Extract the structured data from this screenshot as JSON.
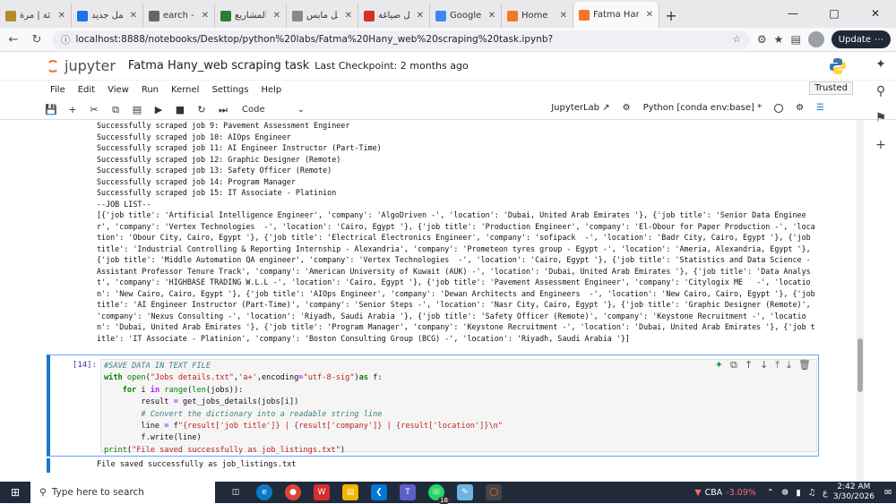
{
  "browser": {
    "tabs": [
      {
        "label": "المحادثة | مرة",
        "color": "#b58a2a"
      },
      {
        "label": "إضافة عمل جديد",
        "color": "#1a73e8"
      },
      {
        "label": "earch - كفيل",
        "color": "#666"
      },
      {
        "label": "المشاريع",
        "color": "#2e7d32"
      },
      {
        "label": "جوجل مابس",
        "color": "#888"
      },
      {
        "label": "محل صياغة",
        "color": "#d93025"
      },
      {
        "label": "Google Gem",
        "color": "#4285f4"
      },
      {
        "label": "Home",
        "color": "#f37726"
      },
      {
        "label": "Fatma Hany_",
        "color": "#f37726"
      }
    ],
    "url": "localhost:8888/notebooks/Desktop/python%20labs/Fatma%20Hany_web%20scraping%20task.ipynb?",
    "update_label": "Update"
  },
  "jupyter": {
    "brand": "jupyter",
    "notebook_title": "Fatma Hany_web scraping task",
    "checkpoint": "Last Checkpoint: 2 months ago",
    "menu": [
      "File",
      "Edit",
      "View",
      "Run",
      "Kernel",
      "Settings",
      "Help"
    ],
    "trusted": "Trusted",
    "cell_type": "Code",
    "jupyterlab_label": "JupyterLab",
    "kernel": "Python [conda env:base] *"
  },
  "output_text": "Successfully scraped job 9: Pavement Assessment Engineer\nSuccessfully scraped job 10: AIOps Engineer\nSuccessfully scraped job 11: AI Engineer Instructor (Part-Time)\nSuccessfully scraped job 12: Graphic Designer (Remote)\nSuccessfully scraped job 13: Safety Officer (Remote)\nSuccessfully scraped job 14: Program Manager\nSuccessfully scraped job 15: IT Associate - Platinion\n--JOB LIST--\n[{'job title': 'Artificial Intelligence Engineer', 'company': 'AlgoDriven -', 'location': 'Dubai, United Arab Emirates '}, {'job title': 'Senior Data Engineer', 'company': 'Vertex Technologies  -', 'location': 'Cairo, Egypt '}, {'job title': 'Production Engineer', 'company': 'El-Obour for Paper Production -', 'location': 'Obour City, Cairo, Egypt '}, {'job title': 'Electrical Electronics Engineer', 'company': 'sofipack  -', 'location': 'Badr City, Cairo, Egypt '}, {'job title': 'Industrial Controlling & Reporting Internship - Alexandria', 'company': 'Prometeon tyres group - Egypt -', 'location': 'Ameria, Alexandria, Egypt '}, {'job title': 'Middle Automation QA engineer', 'company': 'Vertex Technologies  -', 'location': 'Cairo, Egypt '}, {'job title': 'Statistics and Data Science - Assistant Professor Tenure Track', 'company': 'American University of Kuwait (AUK) -', 'location': 'Dubai, United Arab Emirates '}, {'job title': 'Data Analyst', 'company': 'HIGHBASE TRADING W.L.L -', 'location': 'Cairo, Egypt '}, {'job title': 'Pavement Assessment Engineer', 'company': 'Citylogix ME   -', 'location': 'New Cairo, Cairo, Egypt '}, {'job title': 'AIOps Engineer', 'company': 'Dewan Architects and Engineers  -', 'location': 'New Cairo, Cairo, Egypt '}, {'job title': 'AI Engineer Instructor (Part-Time)', 'company': 'Senior Steps -', 'location': 'Nasr City, Cairo, Egypt '}, {'job title': 'Graphic Designer (Remote)', 'company': 'Nexus Consulting -', 'location': 'Riyadh, Saudi Arabia '}, {'job title': 'Safety Officer (Remote)', 'company': 'Keystone Recruitment -', 'location': 'Dubai, United Arab Emirates '}, {'job title': 'Program Manager', 'company': 'Keystone Recruitment -', 'location': 'Dubai, United Arab Emirates '}, {'job title': 'IT Associate - Platinion', 'company': 'Boston Consulting Group (BCG) -', 'location': 'Riyadh, Saudi Arabia '}]",
  "cell": {
    "prompt": "[14]:",
    "lines": {
      "l1": "#SAVE DATA IN TEXT FILE",
      "l7": "# Convert the dictionary into a readable string line"
    },
    "output": "File saved successfully as job_listings.txt"
  },
  "taskbar": {
    "search_placeholder": "Type here to search",
    "stock_name": "CBA",
    "stock_change": "-3.09%",
    "time": "2:42 AM",
    "date": "3/30/2026",
    "whatsapp_badge": "18"
  }
}
